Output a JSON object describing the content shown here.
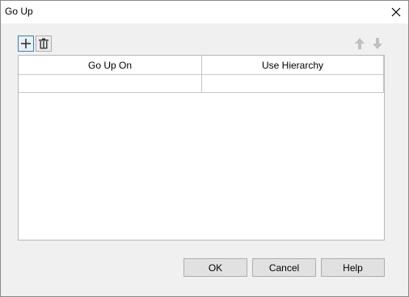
{
  "window": {
    "title": "Go Up",
    "close_icon": "close-icon"
  },
  "toolbar": {
    "add_icon": "plus-icon",
    "delete_icon": "trash-icon",
    "move_up_icon": "arrow-up-icon",
    "move_down_icon": "arrow-down-icon",
    "move_buttons_enabled": false
  },
  "grid": {
    "columns": [
      "Go Up On",
      "Use Hierarchy"
    ],
    "rows": [
      [
        "",
        ""
      ]
    ]
  },
  "buttons": {
    "ok": "OK",
    "cancel": "Cancel",
    "help": "Help"
  },
  "colors": {
    "accent": "#3c7fb1",
    "disabled_arrow": "#c0c0c0"
  }
}
